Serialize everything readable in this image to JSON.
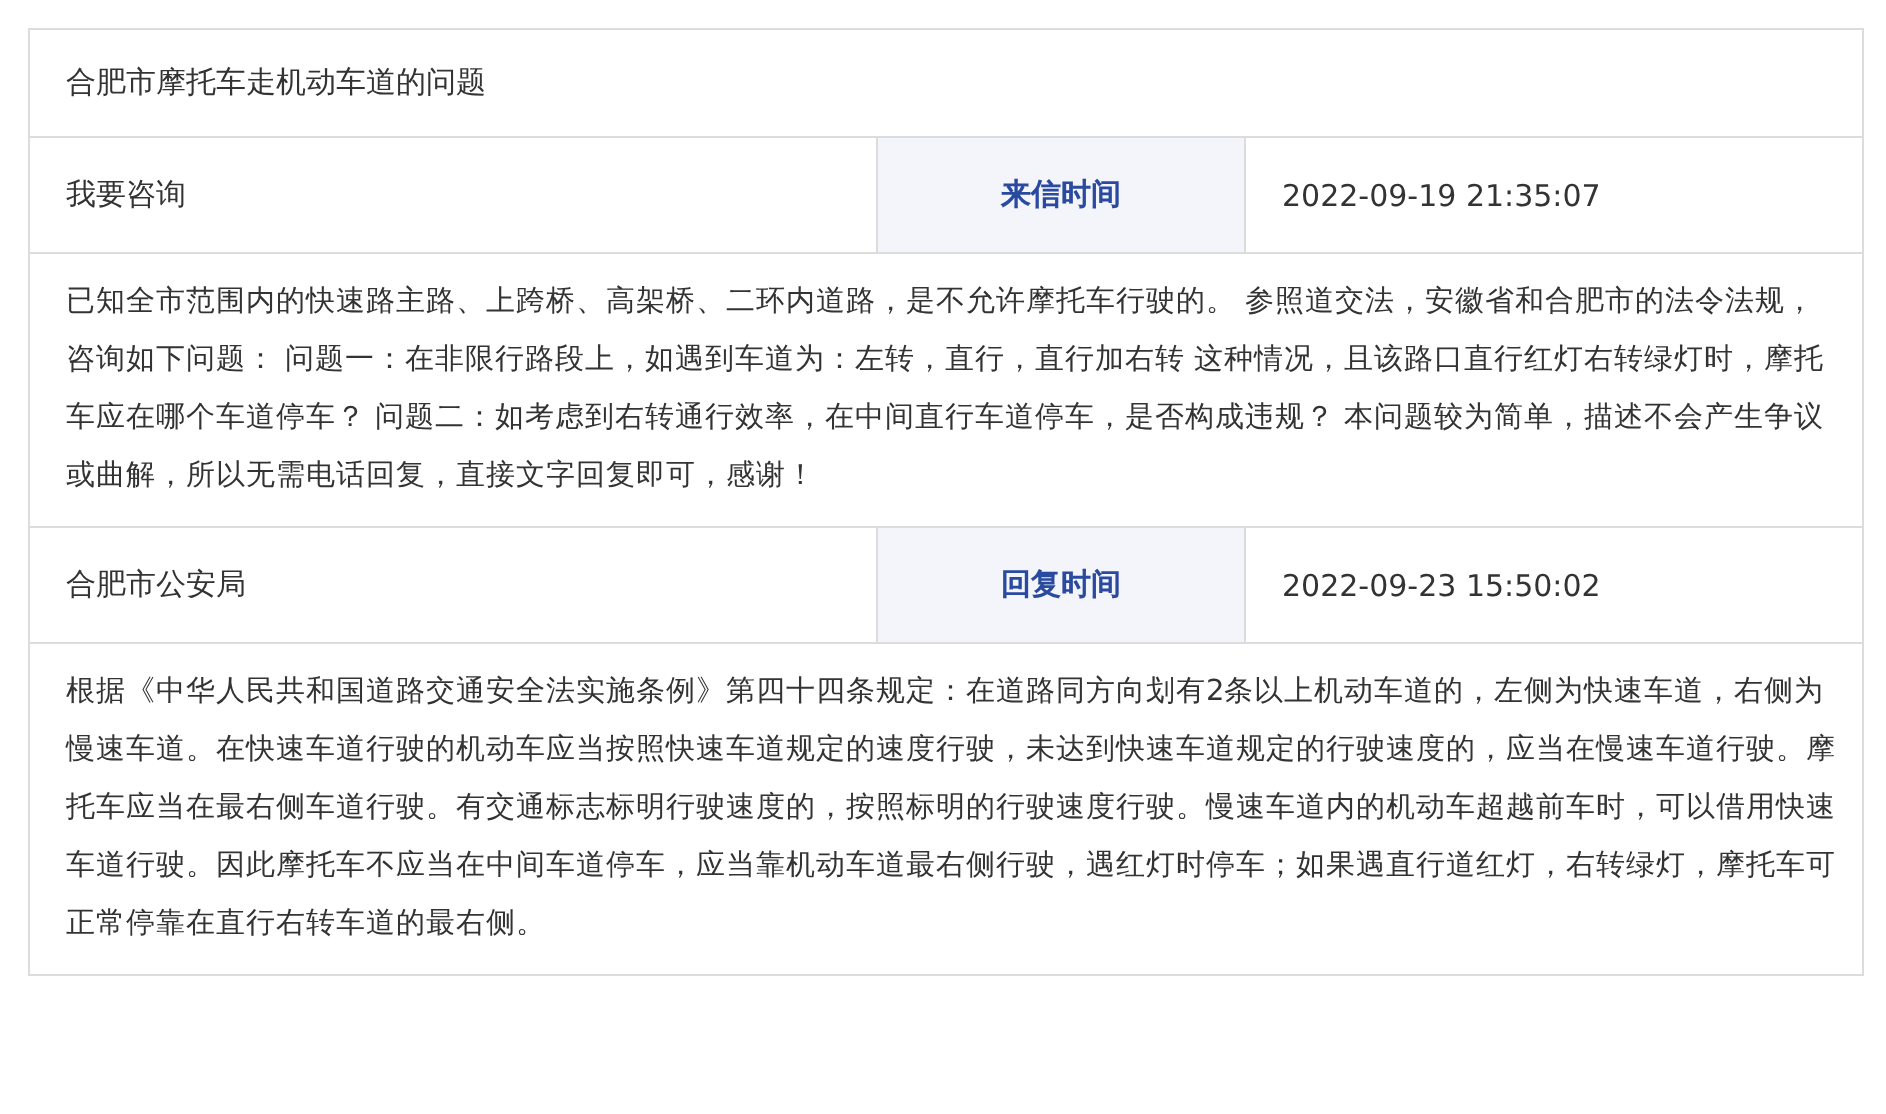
{
  "title": "合肥市摩托车走机动车道的问题",
  "question_meta": {
    "name": "我要咨询",
    "label": "来信时间",
    "time": "2022-09-19 21:35:07"
  },
  "question_text": "已知全市范围内的快速路主路、上跨桥、高架桥、二环内道路，是不允许摩托车行驶的。 参照道交法，安徽省和合肥市的法令法规，咨询如下问题： 问题一：在非限行路段上，如遇到车道为：左转，直行，直行加右转 这种情况，且该路口直行红灯右转绿灯时，摩托车应在哪个车道停车？ 问题二：如考虑到右转通行效率，在中间直行车道停车，是否构成违规？ 本问题较为简单，描述不会产生争议或曲解，所以无需电话回复，直接文字回复即可，感谢！",
  "reply_meta": {
    "name": "合肥市公安局",
    "label": "回复时间",
    "time": "2022-09-23 15:50:02"
  },
  "reply_text": "根据《中华人民共和国道路交通安全法实施条例》第四十四条规定：在道路同方向划有2条以上机动车道的，左侧为快速车道，右侧为慢速车道。在快速车道行驶的机动车应当按照快速车道规定的速度行驶，未达到快速车道规定的行驶速度的，应当在慢速车道行驶。摩托车应当在最右侧车道行驶。有交通标志标明行驶速度的，按照标明的行驶速度行驶。慢速车道内的机动车超越前车时，可以借用快速车道行驶。因此摩托车不应当在中间车道停车，应当靠机动车道最右侧行驶，遇红灯时停车；如果遇直行道红灯，右转绿灯，摩托车可正常停靠在直行右转车道的最右侧。"
}
